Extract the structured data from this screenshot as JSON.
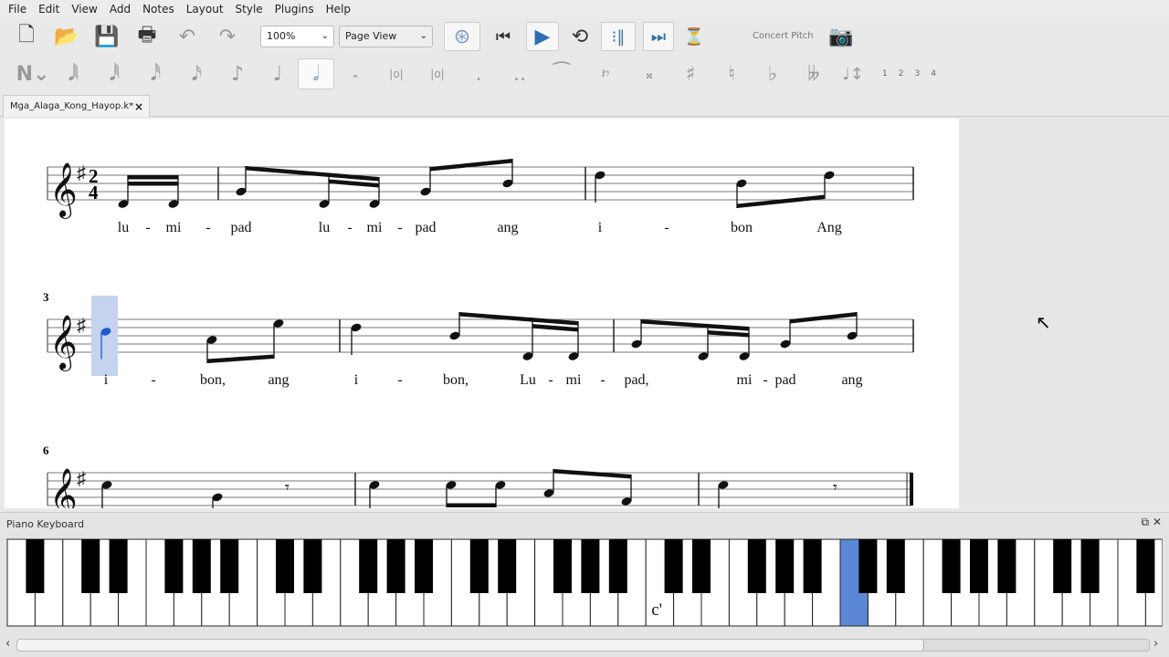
{
  "menu": [
    "File",
    "Edit",
    "View",
    "Add",
    "Notes",
    "Layout",
    "Style",
    "Plugins",
    "Help"
  ],
  "toolbar": {
    "zoom": "100%",
    "view_mode": "Page View",
    "concert_pitch": "Concert Pitch",
    "file_icons": [
      "new-score",
      "open",
      "save",
      "print",
      "undo",
      "redo"
    ],
    "playback_icons": [
      "midi-input",
      "rewind",
      "play",
      "loop",
      "repeat",
      "pan",
      "metronome"
    ],
    "play_color": "#2f6fb1",
    "voices": [
      "1",
      "2",
      "3",
      "4"
    ],
    "selected_duration": "half"
  },
  "tab": {
    "title": "Mga_Alaga_Kong_Hayop.k*"
  },
  "score": {
    "key_signature": "G major (1 sharp)",
    "time_signature": {
      "top": "2",
      "bottom": "4"
    },
    "selection_color": "#c5d3ee",
    "selected_note_color": "#1a5ccc",
    "systems": [
      {
        "measure_number": "",
        "notes": [
          "D4",
          "D4",
          "G4",
          "D4",
          "D4",
          "G4",
          "B4",
          "D5",
          "B4",
          "D5"
        ],
        "lyrics": [
          "lu",
          "-",
          "mi",
          "-",
          "pad",
          "lu",
          "-",
          "mi",
          "-",
          "pad",
          "ang",
          "i",
          "-",
          "bon",
          "Ang"
        ]
      },
      {
        "measure_number": "3",
        "notes": [
          "C5",
          "A4",
          "E5",
          "D5",
          "B4",
          "D4",
          "D4",
          "G4",
          "D4",
          "D4",
          "G4",
          "B4"
        ],
        "lyrics": [
          "i",
          "-",
          "bon,",
          "ang",
          "i",
          "-",
          "bon,",
          "Lu",
          "-",
          "mi",
          "-",
          "pad,",
          "mi",
          "-",
          "pad",
          "ang"
        ]
      },
      {
        "measure_number": "6",
        "notes": [
          "C5",
          "G4",
          "rest",
          "C5",
          "C5",
          "C5",
          "A4",
          "F4",
          "C5",
          "rest"
        ],
        "lyrics": []
      }
    ]
  },
  "piano": {
    "title": "Piano Keyboard",
    "octave_label": "c'",
    "highlighted_key": "c''",
    "highlight_color": "#5b87d6"
  }
}
